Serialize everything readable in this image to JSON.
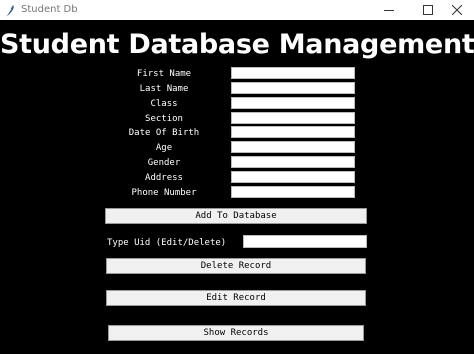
{
  "window": {
    "title": "Student Db",
    "icon": "feather-icon"
  },
  "heading": "Student Database Management",
  "fields": [
    {
      "label": "First Name",
      "value": ""
    },
    {
      "label": "Last Name",
      "value": ""
    },
    {
      "label": "Class",
      "value": ""
    },
    {
      "label": "Section",
      "value": ""
    },
    {
      "label": "Date Of Birth",
      "value": ""
    },
    {
      "label": "Age",
      "value": ""
    },
    {
      "label": "Gender",
      "value": ""
    },
    {
      "label": "Address",
      "value": ""
    },
    {
      "label": "Phone Number",
      "value": ""
    }
  ],
  "buttons": {
    "add": "Add To Database",
    "delete": "Delete Record",
    "edit": "Edit Record",
    "show": "Show Records"
  },
  "uid": {
    "label": "Type Uid (Edit/Delete)",
    "value": ""
  },
  "colors": {
    "background": "#000000",
    "text": "#ffffff",
    "button": "#f0f0f0"
  }
}
